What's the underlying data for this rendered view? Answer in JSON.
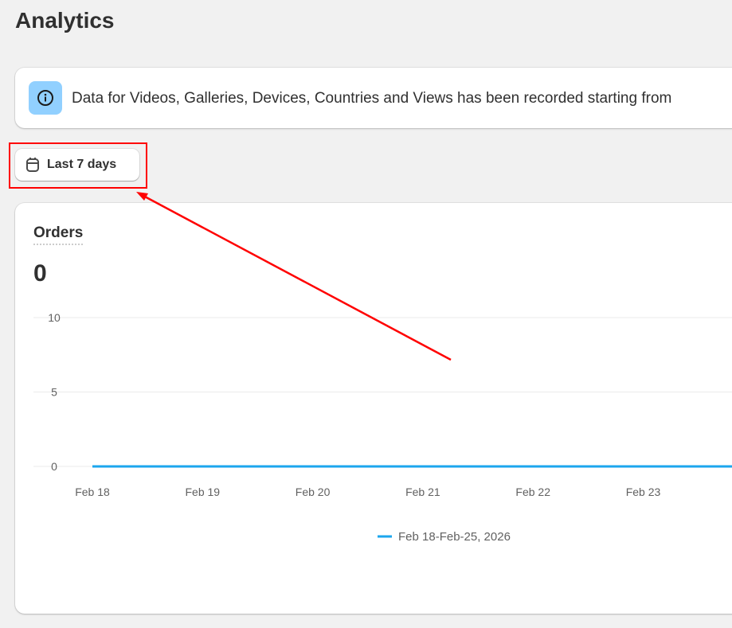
{
  "page": {
    "title": "Analytics"
  },
  "notice": {
    "icon": "info-icon",
    "text": "Data for Videos, Galleries, Devices, Countries and Views has been recorded starting from"
  },
  "date_filter": {
    "icon": "calendar-icon",
    "label": "Last 7 days"
  },
  "orders_card": {
    "title": "Orders",
    "value": "0"
  },
  "colors": {
    "series": "#1ba6ee",
    "annotation": "#ff0000",
    "notice_icon_bg": "#91d0ff"
  },
  "chart_data": {
    "type": "line",
    "categories": [
      "Feb 18",
      "Feb 19",
      "Feb 20",
      "Feb 21",
      "Feb 22",
      "Feb 23"
    ],
    "series": [
      {
        "name": "Feb 18-Feb-25, 2026",
        "values": [
          0,
          0,
          0,
          0,
          0,
          0
        ]
      }
    ],
    "yticks": [
      "10",
      "5",
      "0"
    ],
    "ylim": [
      0,
      10
    ],
    "grid": true,
    "legend": "bottom"
  }
}
